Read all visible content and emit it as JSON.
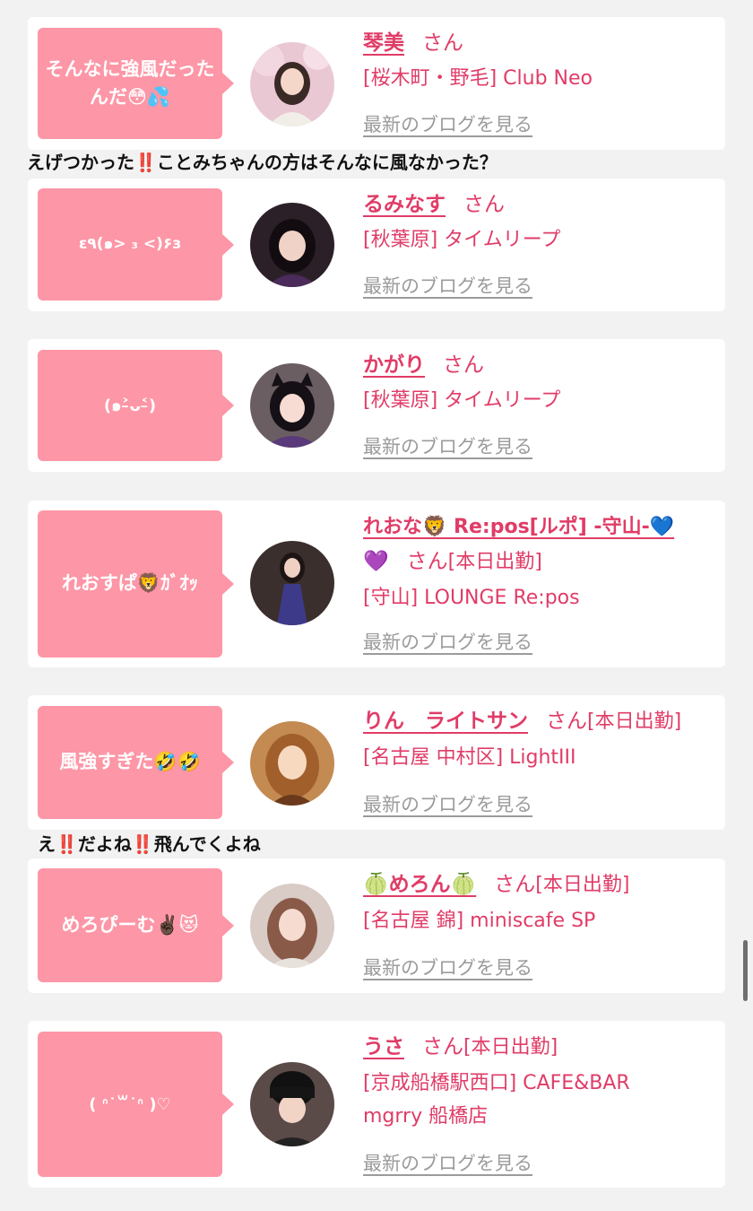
{
  "colors": {
    "bubble": "#fd96a6",
    "name": "#e03c67",
    "blog_link": "#9b9b9b",
    "reply_mark": "#e01020"
  },
  "posts": [
    {
      "message": "そんなに強風だったんだ😳💦",
      "name": "琴美",
      "suffix": "さん",
      "status": "",
      "shop": "[桜木町・野毛] Club Neo",
      "shop_line2": "",
      "blog_link": "最新のブログを見る",
      "avatar_icon": "girl-pink-blossom-avatar",
      "reply": {
        "pre": "えげつかった",
        "mark1": "‼️",
        "mid": "ことみちゃんの方はそんなに風なかった？",
        "mark2": "",
        "post": ""
      }
    },
    {
      "message": "ε٩(๑> ₃ <)۶з",
      "name": "るみなす",
      "suffix": "さん",
      "status": "",
      "shop": "[秋葉原] タイムリープ",
      "shop_line2": "",
      "blog_link": "最新のブログを見る",
      "avatar_icon": "girl-dark-hair-avatar"
    },
    {
      "message": "(๑˃̵ᴗ˂̵)",
      "name": "かがり",
      "suffix": "さん",
      "status": "",
      "shop": "[秋葉原] タイムリープ",
      "shop_line2": "",
      "blog_link": "最新のブログを見る",
      "avatar_icon": "girl-cat-ears-avatar"
    },
    {
      "message": "れおすぱ🦁ｶﾞｵｯ",
      "name": "れおな🦁 Re:pos[ルポ] -守山-💙",
      "name_line2": "💜",
      "suffix": "さん",
      "status": "[本日出勤]",
      "shop": "[守山] LOUNGE Re:pos",
      "shop_line2": "",
      "blog_link": "最新のブログを見る",
      "avatar_icon": "girl-purple-dress-avatar"
    },
    {
      "message": "風強すぎた🤣🤣",
      "name": "りん　ライトサン",
      "suffix": "さん",
      "status": "[本日出勤]",
      "shop": "[名古屋 中村区] LightIII",
      "shop_line2": "",
      "blog_link": "最新のブログを見る",
      "avatar_icon": "anime-girl-avatar",
      "reply": {
        "pre": "え",
        "mark1": "‼️",
        "mid": "だよね",
        "mark2": "‼️",
        "post": "飛んでくよね"
      }
    },
    {
      "message": "めろぴーむ✌🏿😻",
      "name": "🍈めろん🍈",
      "suffix": "さん",
      "status": "[本日出勤]",
      "shop": "[名古屋 錦] miniscafe SP",
      "shop_line2": "",
      "blog_link": "最新のブログを見る",
      "avatar_icon": "girl-long-hair-avatar"
    },
    {
      "message": "( ᐢ˙꒳˙ᐢ )♡",
      "name": "うさ",
      "suffix": "さん",
      "status": "[本日出勤]",
      "shop": "[京成船橋駅西口] CAFE&BAR",
      "shop_line2": "mgrry 船橋店",
      "blog_link": "最新のブログを見る",
      "avatar_icon": "girl-black-hat-avatar"
    }
  ]
}
